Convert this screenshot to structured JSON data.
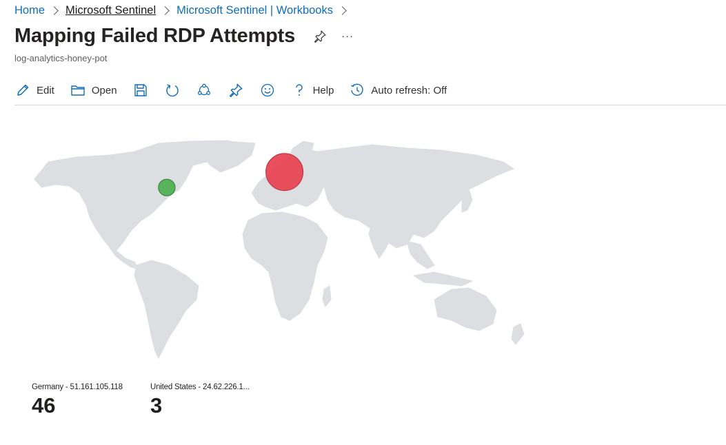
{
  "breadcrumb": {
    "items": [
      "Home",
      "Microsoft Sentinel",
      "Microsoft Sentinel | Workbooks"
    ]
  },
  "header": {
    "title": "Mapping Failed RDP Attempts",
    "subtitle": "log-analytics-honey-pot",
    "more_label": "···"
  },
  "toolbar": {
    "edit": "Edit",
    "open": "Open",
    "help": "Help",
    "auto_refresh": "Auto refresh: Off",
    "icons": [
      "edit-icon",
      "open-folder-icon",
      "save-icon",
      "refresh-icon",
      "share-icon",
      "pin-icon",
      "feedback-smiley-icon",
      "help-icon",
      "auto-refresh-icon"
    ]
  },
  "map": {
    "land_color": "#dcdee2",
    "points": [
      {
        "label": "Germany - 51.161.105.118",
        "value": 46,
        "lat": 51,
        "lon": 10,
        "color": "#e8404f"
      },
      {
        "label": "United States - 24.62.226.1...",
        "value": 3,
        "lat": 40,
        "lon": -73,
        "color": "#4caf50"
      }
    ]
  },
  "tiles": [
    {
      "label": "Germany - 51.161.105.118",
      "value": "46"
    },
    {
      "label": "United States - 24.62.226.1...",
      "value": "3"
    }
  ],
  "colors": {
    "link": "#0f6cbd",
    "accent_red": "#e8404f",
    "accent_green": "#4caf50"
  }
}
